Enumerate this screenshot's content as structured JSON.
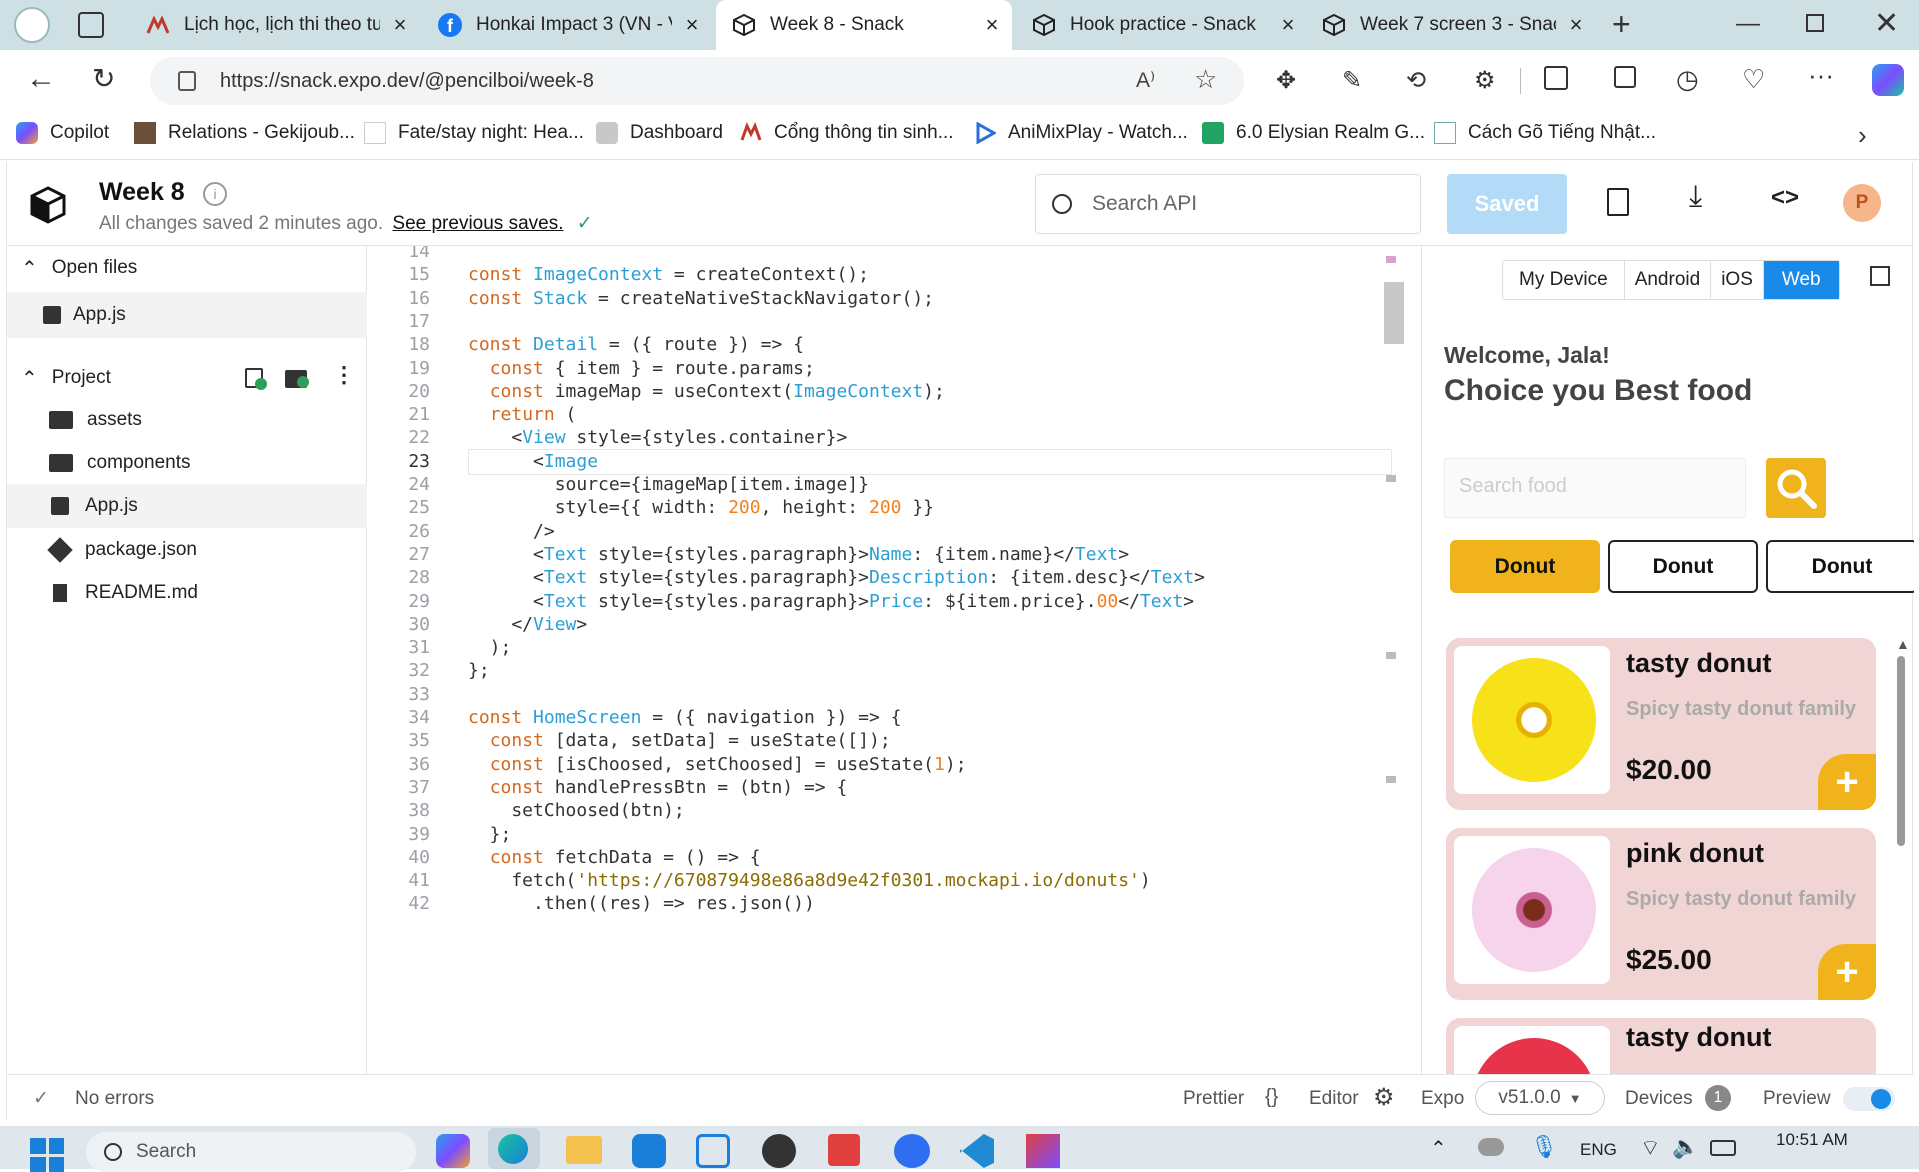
{
  "browser": {
    "tabs": [
      {
        "title": "Lịch học, lịch thi theo tuầ",
        "active": false
      },
      {
        "title": "Honkai Impact 3 (VN - Vi",
        "active": false
      },
      {
        "title": "Week 8 - Snack",
        "active": true
      },
      {
        "title": "Hook practice - Snack",
        "active": false
      },
      {
        "title": "Week 7 screen 3 - Snack",
        "active": false
      }
    ],
    "new_tab": "+",
    "url": "https://snack.expo.dev/@pencilboi/week-8",
    "bookmarks": [
      "Copilot",
      "Relations - Gekijoub...",
      "Fate/stay night: Hea...",
      "Dashboard",
      "Cổng thông tin sinh...",
      "AniMixPlay - Watch...",
      "6.0 Elysian Realm G...",
      "Cách Gõ Tiếng Nhật..."
    ]
  },
  "snack": {
    "title": "Week 8",
    "save_status": "All changes saved 2 minutes ago.",
    "previous_saves": "See previous saves.",
    "search_placeholder": "Search API",
    "saved_button": "Saved",
    "avatar_letter": "P"
  },
  "sidebar": {
    "open_files_label": "Open files",
    "open_files": [
      "App.js"
    ],
    "project_label": "Project",
    "project_items": [
      {
        "name": "assets",
        "type": "folder"
      },
      {
        "name": "components",
        "type": "folder"
      },
      {
        "name": "App.js",
        "type": "js"
      },
      {
        "name": "package.json",
        "type": "package"
      },
      {
        "name": "README.md",
        "type": "file"
      }
    ]
  },
  "editor": {
    "lines": [
      {
        "n": "14",
        "t": ""
      },
      {
        "n": "15",
        "t": "const ImageContext = createContext();"
      },
      {
        "n": "16",
        "t": "const Stack = createNativeStackNavigator();"
      },
      {
        "n": "17",
        "t": ""
      },
      {
        "n": "18",
        "t": "const Detail = ({ route }) => {"
      },
      {
        "n": "19",
        "t": "  const { item } = route.params;"
      },
      {
        "n": "20",
        "t": "  const imageMap = useContext(ImageContext);"
      },
      {
        "n": "21",
        "t": "  return ("
      },
      {
        "n": "22",
        "t": "    <View style={styles.container}>"
      },
      {
        "n": "23",
        "t": "      <Image"
      },
      {
        "n": "24",
        "t": "        source={imageMap[item.image]}"
      },
      {
        "n": "25",
        "t": "        style={{ width: 200, height: 200 }}"
      },
      {
        "n": "26",
        "t": "      />"
      },
      {
        "n": "27",
        "t": "      <Text style={styles.paragraph}>Name: {item.name}</Text>"
      },
      {
        "n": "28",
        "t": "      <Text style={styles.paragraph}>Description: {item.desc}</Text>"
      },
      {
        "n": "29",
        "t": "      <Text style={styles.paragraph}>Price: ${item.price}.00</Text>"
      },
      {
        "n": "30",
        "t": "    </View>"
      },
      {
        "n": "31",
        "t": "  );"
      },
      {
        "n": "32",
        "t": "};"
      },
      {
        "n": "33",
        "t": ""
      },
      {
        "n": "34",
        "t": "const HomeScreen = ({ navigation }) => {"
      },
      {
        "n": "35",
        "t": "  const [data, setData] = useState([]);"
      },
      {
        "n": "36",
        "t": "  const [isChoosed, setChoosed] = useState(1);"
      },
      {
        "n": "37",
        "t": "  const handlePressBtn = (btn) => {"
      },
      {
        "n": "38",
        "t": "    setChoosed(btn);"
      },
      {
        "n": "39",
        "t": "  };"
      },
      {
        "n": "40",
        "t": "  const fetchData = () => {"
      },
      {
        "n": "41",
        "t": "    fetch('https://670879498e86a8d9e42f0301.mockapi.io/donuts')"
      },
      {
        "n": "42",
        "t": "      .then((res) => res.json())"
      }
    ]
  },
  "preview": {
    "device_tabs": [
      "My Device",
      "Android",
      "iOS",
      "Web"
    ],
    "active_device_tab": "Web",
    "welcome": "Welcome, Jala!",
    "headline": "Choice you Best food",
    "search_placeholder": "Search food",
    "categories": [
      "Donut",
      "Donut",
      "Donut"
    ],
    "items": [
      {
        "name": "tasty donut",
        "desc": "Spicy tasty donut family",
        "price": "$20.00",
        "color": "yellow"
      },
      {
        "name": "pink donut",
        "desc": "Spicy tasty donut family",
        "price": "$25.00",
        "color": "pink"
      },
      {
        "name": "tasty donut",
        "desc": "",
        "price": "",
        "color": "red"
      }
    ],
    "accent": "#f1b31c"
  },
  "footer": {
    "errors": "No errors",
    "prettier": "Prettier",
    "editor": "Editor",
    "expo": "Expo",
    "version": "v51.0.0",
    "devices": "Devices",
    "devices_count": "1",
    "preview": "Preview"
  },
  "taskbar": {
    "search": "Search",
    "lang": "ENG",
    "time": "10:51 AM"
  }
}
